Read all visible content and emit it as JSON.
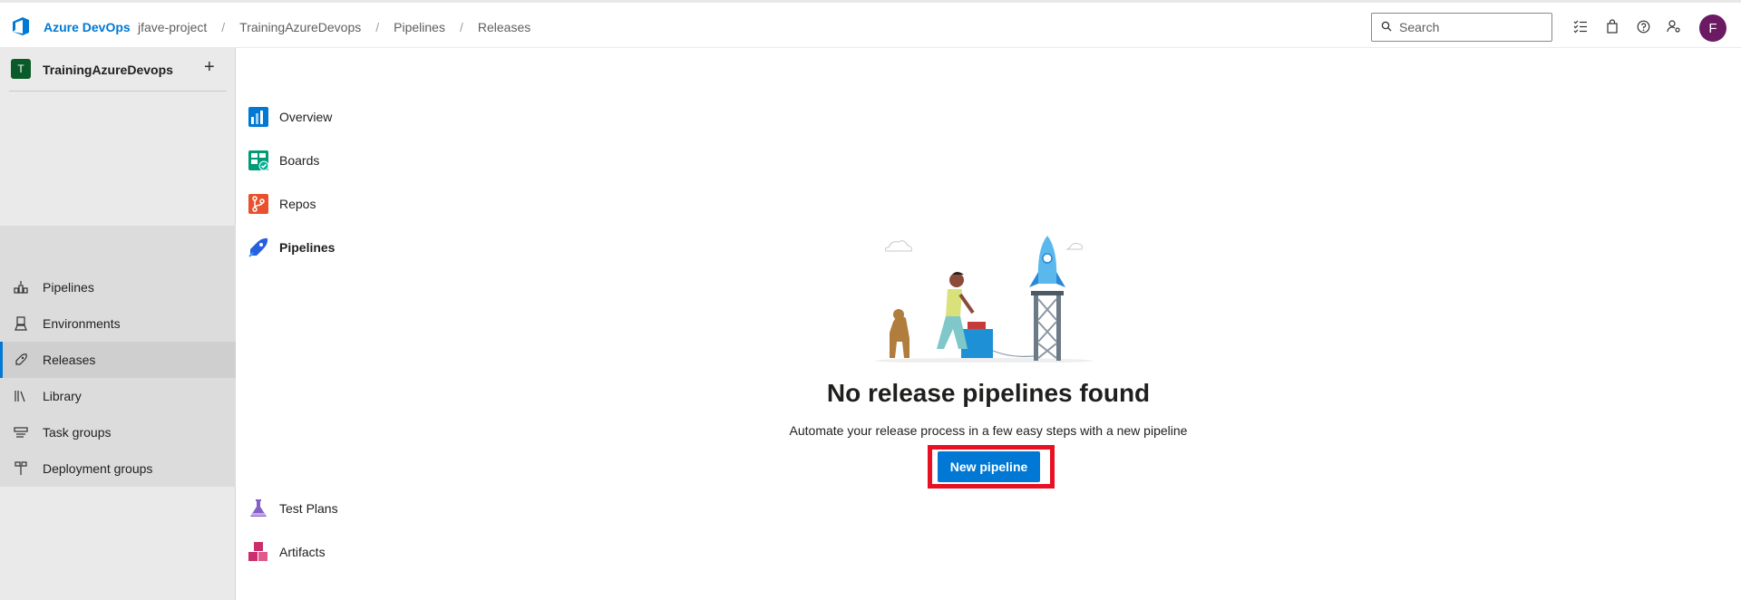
{
  "header": {
    "brand": "Azure DevOps",
    "breadcrumbs": [
      "jfave-project",
      "TrainingAzureDevops",
      "Pipelines",
      "Releases"
    ],
    "search_placeholder": "Search",
    "icons": [
      "task-list-icon",
      "shopping-bag-icon",
      "help-icon",
      "user-settings-icon"
    ],
    "avatar_initial": "F"
  },
  "sidebar": {
    "project_initial": "T",
    "project_name": "TrainingAzureDevops",
    "add_label": "+",
    "items": [
      {
        "label": "Overview",
        "icon": "overview-icon"
      },
      {
        "label": "Boards",
        "icon": "boards-icon"
      },
      {
        "label": "Repos",
        "icon": "repos-icon"
      },
      {
        "label": "Pipelines",
        "icon": "pipelines-icon"
      },
      {
        "label": "Pipelines",
        "icon": "pipelines-sub-icon"
      },
      {
        "label": "Environments",
        "icon": "environments-icon"
      },
      {
        "label": "Releases",
        "icon": "releases-icon",
        "selected": true
      },
      {
        "label": "Library",
        "icon": "library-icon"
      },
      {
        "label": "Task groups",
        "icon": "task-groups-icon"
      },
      {
        "label": "Deployment groups",
        "icon": "deployment-groups-icon"
      },
      {
        "label": "Test Plans",
        "icon": "test-plans-icon"
      },
      {
        "label": "Artifacts",
        "icon": "artifacts-icon"
      }
    ]
  },
  "main": {
    "heading": "No release pipelines found",
    "subtext": "Automate your release process in a few easy steps with a new pipeline",
    "new_pipeline_label": "New pipeline"
  },
  "colors": {
    "accent": "#0078d4",
    "highlight": "#e81123",
    "avatar": "#6b1a63",
    "sidebar_bg": "#eaeaea"
  }
}
